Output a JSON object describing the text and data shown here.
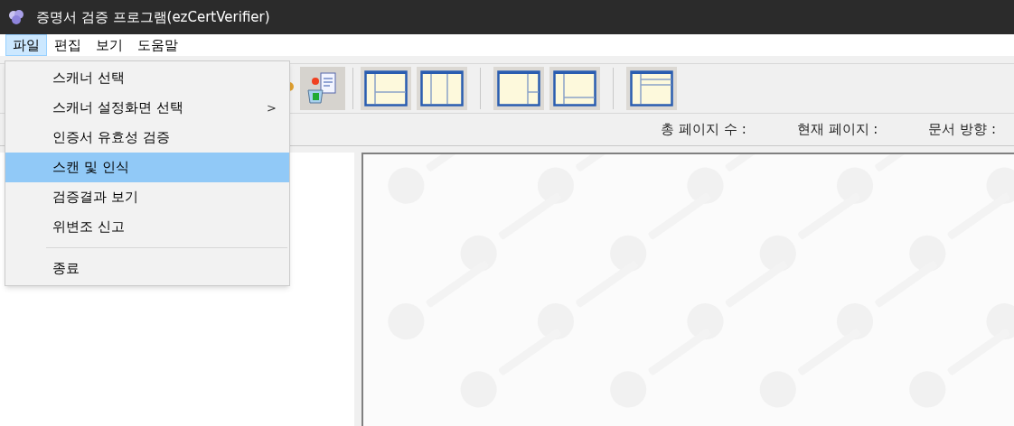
{
  "window": {
    "title": "증명서 검증 프로그램(ezCertVerifier)"
  },
  "menu_bar": [
    {
      "label": "파일",
      "selected": true
    },
    {
      "label": "편집",
      "selected": false
    },
    {
      "label": "보기",
      "selected": false
    },
    {
      "label": "도움말",
      "selected": false
    }
  ],
  "file_menu": [
    {
      "kind": "item",
      "label": "스캐너 선택",
      "selected": false
    },
    {
      "kind": "item",
      "label": "스캐너 설정화면 선택",
      "submenu_arrow": ">",
      "selected": false
    },
    {
      "kind": "item",
      "label": "인증서 유효성 검증",
      "selected": false
    },
    {
      "kind": "item",
      "label": "스캔 및 인식",
      "selected": true
    },
    {
      "kind": "item",
      "label": "검증결과 보기",
      "selected": false
    },
    {
      "kind": "item",
      "label": "위변조 신고",
      "selected": false
    },
    {
      "kind": "separator"
    },
    {
      "kind": "item",
      "label": "종료",
      "selected": false
    }
  ],
  "info_bar": [
    "총 페이지 수 :",
    "현재 페이지 :",
    "문서 방향 :"
  ],
  "viewer": {
    "kind": "picture"
  }
}
